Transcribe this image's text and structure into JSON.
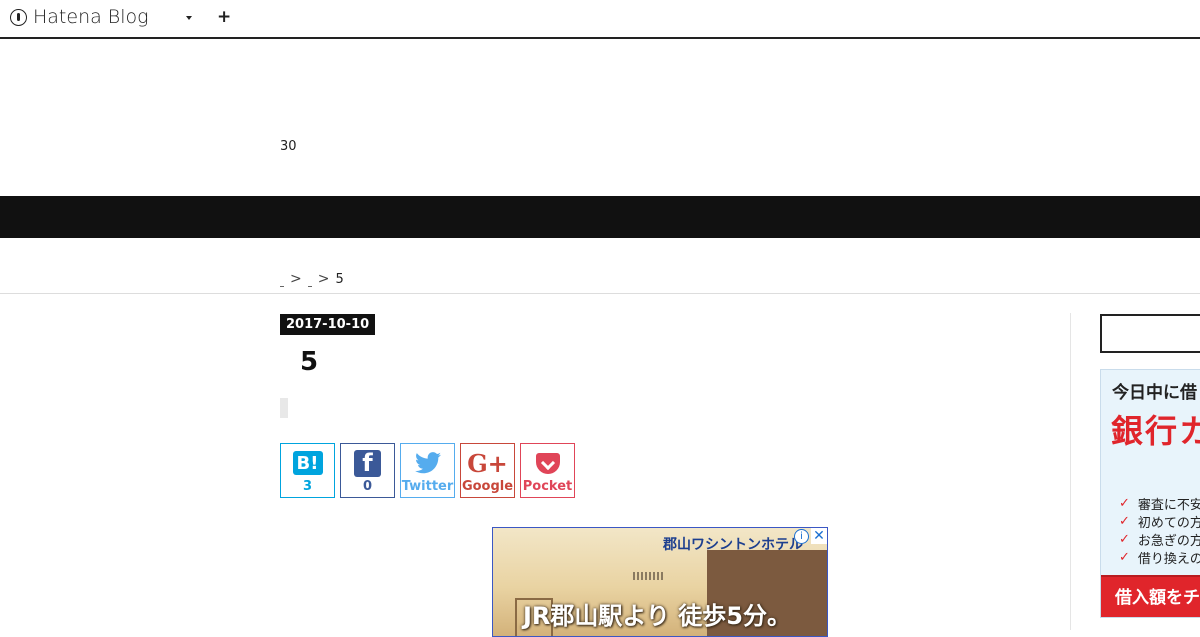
{
  "topbar": {
    "brand": "Hatena Blog",
    "add_symbol": "+"
  },
  "blog": {
    "subtitle": "30"
  },
  "breadcrumb": {
    "separator": ">",
    "current": "5"
  },
  "entry": {
    "date": "2017-10-10",
    "title": "5"
  },
  "share": {
    "hatena": {
      "icon": "B!",
      "count": "3"
    },
    "facebook": {
      "icon": "f",
      "count": "0"
    },
    "twitter": {
      "label": "Twitter"
    },
    "google": {
      "icon": "G+",
      "label": "Google"
    },
    "pocket": {
      "label": "Pocket"
    }
  },
  "article_ad": {
    "hotel_name": "郡山ワシントンホテル",
    "headline": "JR郡山駅より 徒歩5分。",
    "info_symbol": "i",
    "close_symbol": "✕"
  },
  "sidebar_ad": {
    "line1": "今日中に借",
    "line2": "銀行カ",
    "items": [
      "審査に不安",
      "初めての方",
      "お急ぎの方",
      "借り換えの"
    ],
    "cta": "借入額をチ",
    "check_symbol": "✓"
  },
  "colors": {
    "nav_bg": "#111111",
    "hatena_blue": "#00a4de",
    "facebook_blue": "#3b5998",
    "twitter_blue": "#55acee",
    "google_red": "#c8473a",
    "pocket_red": "#e04558",
    "ad_red": "#e0252b"
  }
}
